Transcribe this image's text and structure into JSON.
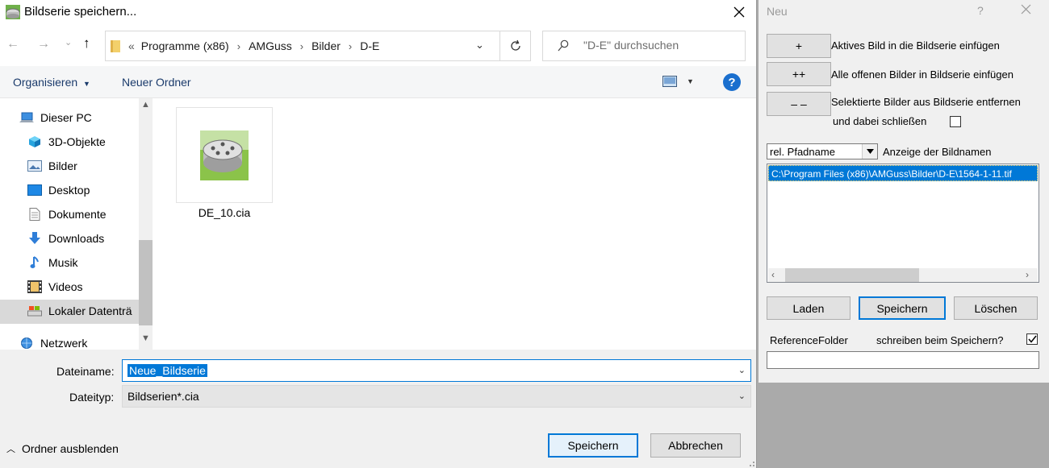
{
  "save_dialog": {
    "title": "Bildserie speichern...",
    "address": {
      "overflow": "«",
      "crumbs": [
        "Programme (x86)",
        "AMGuss",
        "Bilder",
        "D-E"
      ]
    },
    "search_placeholder": "\"D-E\" durchsuchen",
    "toolbar": {
      "organize": "Organisieren",
      "new_folder": "Neuer Ordner"
    },
    "nav": [
      {
        "label": "Dieser PC",
        "icon": "computer-icon"
      },
      {
        "label": "3D-Objekte",
        "icon": "cube-icon"
      },
      {
        "label": "Bilder",
        "icon": "pictures-icon"
      },
      {
        "label": "Desktop",
        "icon": "desktop-icon"
      },
      {
        "label": "Dokumente",
        "icon": "document-icon"
      },
      {
        "label": "Downloads",
        "icon": "download-icon"
      },
      {
        "label": "Musik",
        "icon": "music-icon"
      },
      {
        "label": "Videos",
        "icon": "video-icon"
      },
      {
        "label": "Lokaler Datenträ",
        "icon": "drive-icon",
        "selected": true
      },
      {
        "label": "Netzwerk",
        "icon": "network-icon"
      }
    ],
    "files": [
      {
        "name": "DE_10.cia",
        "icon": "image-series-icon"
      }
    ],
    "filename_label": "Dateiname:",
    "filename_value": "Neue_Bildserie",
    "filetype_label": "Dateityp:",
    "filetype_value": "Bildserien*.cia",
    "hide_folders": "Ordner ausblenden",
    "save_label": "Speichern",
    "cancel_label": "Abbrechen",
    "accent_color": "#0078d7"
  },
  "panel": {
    "title": "Neu",
    "help": "?",
    "add_active_button": "+",
    "add_active_label": "Aktives Bild in die Bildserie einfügen",
    "add_all_button": "++",
    "add_all_label": "Alle offenen Bilder in Bildserie einfügen",
    "remove_button": "– –",
    "remove_label": "Selektierte Bilder aus Bildserie entfernen",
    "close_label": "und dabei schließen",
    "close_checked": false,
    "combo_value": "rel. Pfadname",
    "combo_label": "Anzeige der Bildnamen",
    "list_items": [
      "C:\\Program Files (x86)\\AMGuss\\Bilder\\D-E\\1564-1-11.tif"
    ],
    "load_label": "Laden",
    "save_label": "Speichern",
    "delete_label": "Löschen",
    "reference_label": "ReferenceFolder",
    "write_on_save_label": "schreiben beim Speichern?",
    "write_on_save_checked": true,
    "reference_value": ""
  }
}
